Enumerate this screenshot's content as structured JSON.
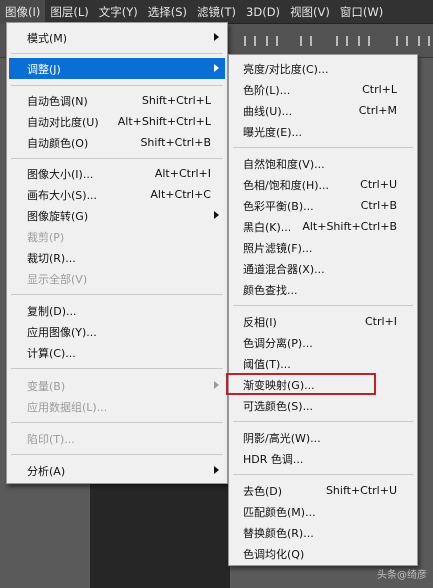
{
  "menubar": [
    {
      "label": "图像(I)",
      "active": true
    },
    {
      "label": "图层(L)"
    },
    {
      "label": "文字(Y)"
    },
    {
      "label": "选择(S)"
    },
    {
      "label": "滤镜(T)"
    },
    {
      "label": "3D(D)"
    },
    {
      "label": "视图(V)"
    },
    {
      "label": "窗口(W)"
    }
  ],
  "image_menu": {
    "items": [
      {
        "label": "模式(M)",
        "shortcut": "",
        "submenu": true
      },
      {
        "label": "调整(J)",
        "shortcut": "",
        "submenu": true,
        "highlighted": true
      },
      {
        "label": "自动色调(N)",
        "shortcut": "Shift+Ctrl+L"
      },
      {
        "label": "自动对比度(U)",
        "shortcut": "Alt+Shift+Ctrl+L"
      },
      {
        "label": "自动颜色(O)",
        "shortcut": "Shift+Ctrl+B"
      },
      {
        "label": "图像大小(I)...",
        "shortcut": "Alt+Ctrl+I"
      },
      {
        "label": "画布大小(S)...",
        "shortcut": "Alt+Ctrl+C"
      },
      {
        "label": "图像旋转(G)",
        "shortcut": "",
        "submenu": true
      },
      {
        "label": "裁剪(P)",
        "shortcut": "",
        "disabled": true
      },
      {
        "label": "裁切(R)...",
        "shortcut": ""
      },
      {
        "label": "显示全部(V)",
        "shortcut": "",
        "disabled": true
      },
      {
        "label": "复制(D)...",
        "shortcut": ""
      },
      {
        "label": "应用图像(Y)...",
        "shortcut": ""
      },
      {
        "label": "计算(C)...",
        "shortcut": ""
      },
      {
        "label": "变量(B)",
        "shortcut": "",
        "submenu": true,
        "disabled": true
      },
      {
        "label": "应用数据组(L)...",
        "shortcut": "",
        "disabled": true
      },
      {
        "label": "陷印(T)...",
        "shortcut": "",
        "disabled": true
      },
      {
        "label": "分析(A)",
        "shortcut": "",
        "submenu": true
      }
    ]
  },
  "adjust_submenu": {
    "items": [
      {
        "label": "亮度/对比度(C)...",
        "shortcut": ""
      },
      {
        "label": "色阶(L)...",
        "shortcut": "Ctrl+L"
      },
      {
        "label": "曲线(U)...",
        "shortcut": "Ctrl+M"
      },
      {
        "label": "曝光度(E)...",
        "shortcut": ""
      },
      {
        "label": "自然饱和度(V)...",
        "shortcut": ""
      },
      {
        "label": "色相/饱和度(H)...",
        "shortcut": "Ctrl+U"
      },
      {
        "label": "色彩平衡(B)...",
        "shortcut": "Ctrl+B"
      },
      {
        "label": "黑白(K)...",
        "shortcut": "Alt+Shift+Ctrl+B"
      },
      {
        "label": "照片滤镜(F)...",
        "shortcut": ""
      },
      {
        "label": "通道混合器(X)...",
        "shortcut": ""
      },
      {
        "label": "颜色查找...",
        "shortcut": ""
      },
      {
        "label": "反相(I)",
        "shortcut": "Ctrl+I"
      },
      {
        "label": "色调分离(P)...",
        "shortcut": ""
      },
      {
        "label": "阈值(T)...",
        "shortcut": ""
      },
      {
        "label": "渐变映射(G)...",
        "shortcut": "",
        "boxed": true
      },
      {
        "label": "可选颜色(S)...",
        "shortcut": ""
      },
      {
        "label": "阴影/高光(W)...",
        "shortcut": ""
      },
      {
        "label": "HDR 色调...",
        "shortcut": ""
      },
      {
        "label": "去色(D)",
        "shortcut": "Shift+Ctrl+U"
      },
      {
        "label": "匹配颜色(M)...",
        "shortcut": ""
      },
      {
        "label": "替换颜色(R)...",
        "shortcut": ""
      },
      {
        "label": "色调均化(Q)",
        "shortcut": ""
      }
    ]
  },
  "watermark": "头条@绮彦",
  "colors": {
    "highlight": "#0a6fd4",
    "annotation_box": "#c0202a"
  }
}
